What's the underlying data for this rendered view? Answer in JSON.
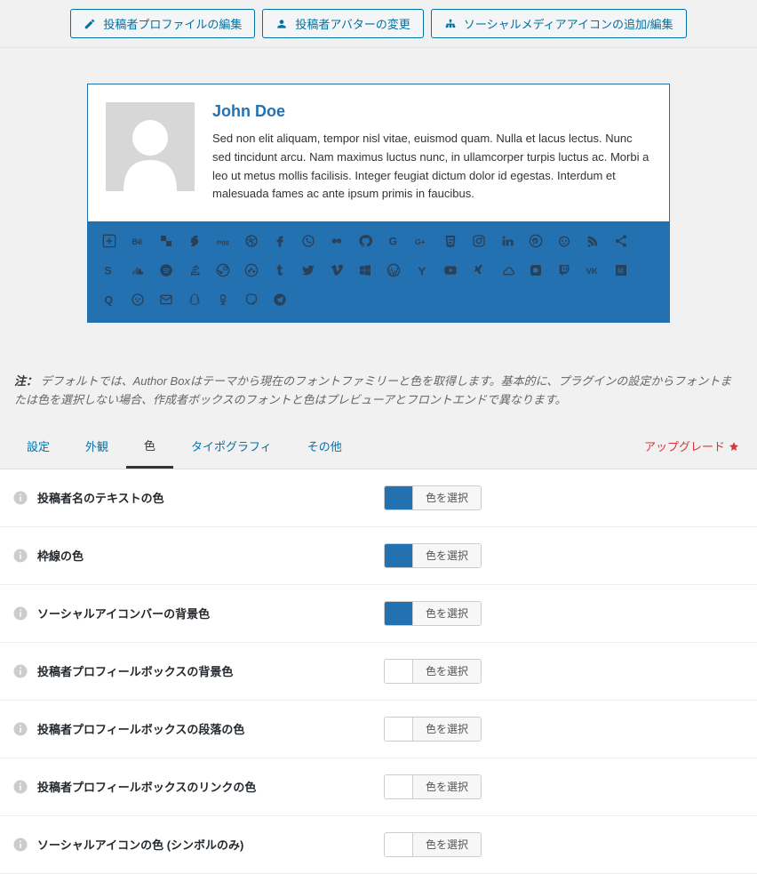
{
  "topbar": {
    "edit_profile": "投稿者プロファイルの編集",
    "change_avatar": "投稿者アバターの変更",
    "social_icons": "ソーシャルメディアアイコンの追加/編集"
  },
  "author": {
    "name": "John Doe",
    "bio": "Sed non elit aliquam, tempor nisl vitae, euismod quam. Nulla et lacus lectus. Nunc sed tincidunt arcu. Nam maximus luctus nunc, in ullamcorper turpis luctus ac. Morbi a leo ut metus mollis facilisis. Integer feugiat dictum dolor id egestas. Interdum et malesuada fames ac ante ipsum primis in faucibus."
  },
  "note_label": "注：",
  "note_text": "デフォルトでは、Author Boxはテーマから現在のフォントファミリーと色を取得します。基本的に、プラグインの設定からフォントまたは色を選択しない場合、作成者ボックスのフォントと色はプレビューアとフロントエンドで異なります。",
  "tabs": {
    "settings": "設定",
    "appearance": "外観",
    "color": "色",
    "typography": "タイポグラフィ",
    "other": "その他"
  },
  "upgrade": "アップグレード",
  "color_btn": "色を選択",
  "rows": [
    {
      "label": "投稿者名のテキストの色",
      "color": "#2471b1"
    },
    {
      "label": "枠線の色",
      "color": "#2471b1"
    },
    {
      "label": "ソーシャルアイコンバーの背景色",
      "color": "#2471b1"
    },
    {
      "label": "投稿者プロフィールボックスの背景色",
      "color": "#ffffff"
    },
    {
      "label": "投稿者プロフィールボックスの段落の色",
      "color": "#ffffff"
    },
    {
      "label": "投稿者プロフィールボックスのリンクの色",
      "color": "#ffffff"
    },
    {
      "label": "ソーシャルアイコンの色 (シンボルのみ)",
      "color": "#ffffff"
    }
  ],
  "social_icons": [
    "plus",
    "behance",
    "delicious",
    "deviantart",
    "digg",
    "dribbble",
    "facebook",
    "whatsapp",
    "flickr",
    "github",
    "google",
    "googleplus",
    "html5",
    "instagram",
    "linkedin",
    "pinterest",
    "reddit",
    "rss",
    "share",
    "skype",
    "soundcloud",
    "spotify",
    "stackoverflow",
    "steam",
    "stumbleupon",
    "tumblr",
    "twitter",
    "vimeo",
    "windows",
    "wordpress",
    "yahoo",
    "youtube",
    "xing",
    "mixcloud",
    "blogger",
    "twitch",
    "vk",
    "medium",
    "quora",
    "meetup",
    "envelope",
    "snapchat",
    "odnoklassniki",
    "mastodon",
    "telegram"
  ]
}
